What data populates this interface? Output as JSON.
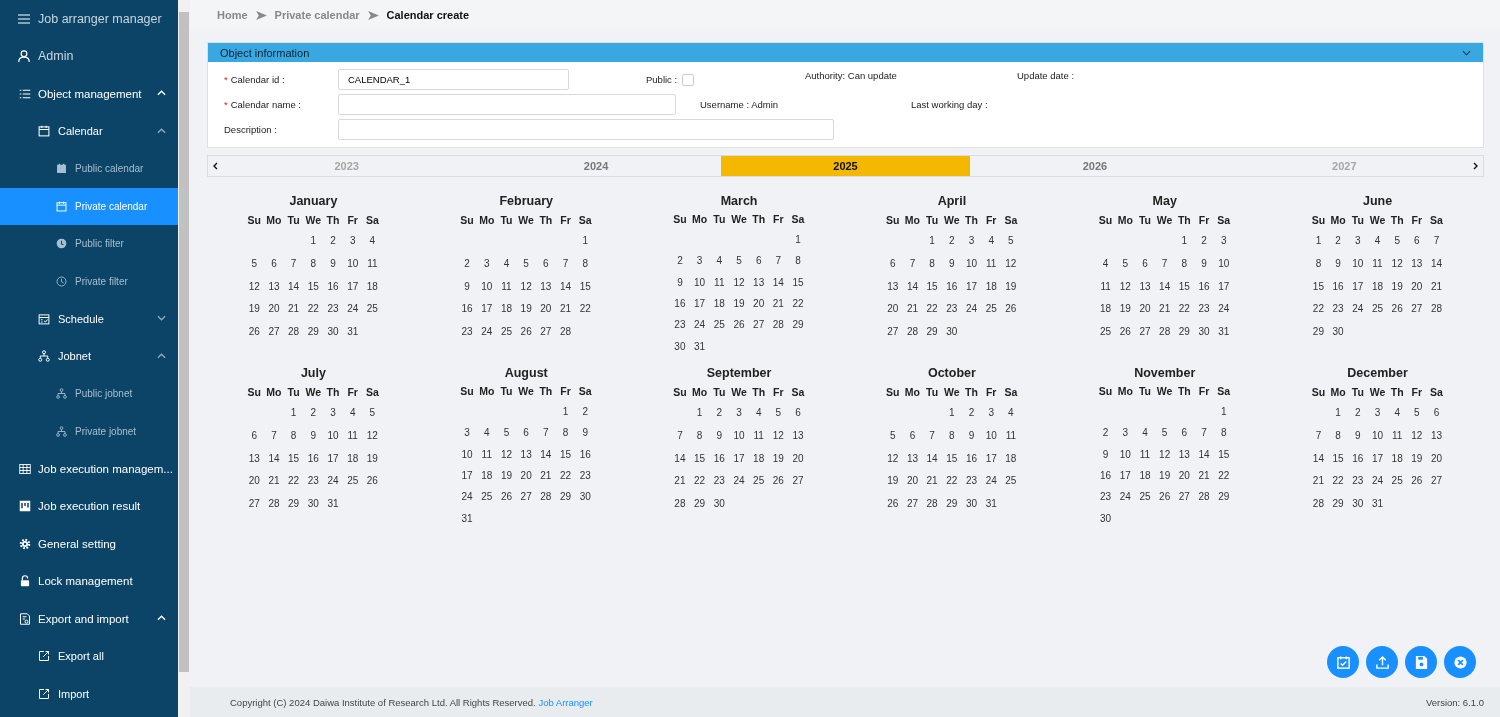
{
  "app": {
    "title": "Job arranger manager"
  },
  "user": {
    "name": "Admin"
  },
  "sidebar": {
    "items": [
      {
        "label": "Object management",
        "selected": false,
        "expanded": true,
        "children": [
          {
            "label": "Calendar",
            "selected": false,
            "expanded": true,
            "children": [
              {
                "label": "Public calendar",
                "selected": false
              },
              {
                "label": "Private calendar",
                "selected": true
              },
              {
                "label": "Public filter",
                "selected": false
              },
              {
                "label": "Private filter",
                "selected": false
              }
            ]
          },
          {
            "label": "Schedule",
            "selected": false,
            "expanded": false
          },
          {
            "label": "Jobnet",
            "selected": false,
            "expanded": true,
            "children": [
              {
                "label": "Public jobnet",
                "selected": false
              },
              {
                "label": "Private jobnet",
                "selected": false
              }
            ]
          }
        ]
      },
      {
        "label": "Job execution managem...",
        "selected": false
      },
      {
        "label": "Job execution result",
        "selected": false
      },
      {
        "label": "General setting",
        "selected": false
      },
      {
        "label": "Lock management",
        "selected": false
      },
      {
        "label": "Export and import",
        "selected": false,
        "expanded": true,
        "children": [
          {
            "label": "Export all",
            "selected": false
          },
          {
            "label": "Import",
            "selected": false
          }
        ]
      }
    ]
  },
  "breadcrumb": [
    {
      "label": "Home",
      "current": false
    },
    {
      "label": "Private calendar",
      "current": false
    },
    {
      "label": "Calendar create",
      "current": true
    }
  ],
  "panel": {
    "title": "Object information",
    "fields": [
      {
        "label": "Calendar id :",
        "mark": "*",
        "value": "CALENDAR_1"
      },
      {
        "label": "Calendar name :",
        "mark": "*"
      },
      {
        "label": "Description :"
      }
    ],
    "public": {
      "label": "Public :",
      "checked": false
    },
    "info": [
      "Authority: Can update",
      "Update date :",
      "Username : Admin",
      "Last working day :"
    ]
  },
  "years": [
    {
      "label": "2023",
      "selected": false,
      "faded": true
    },
    {
      "label": "2024",
      "selected": false,
      "faded": false
    },
    {
      "label": "2025",
      "selected": true,
      "faded": false
    },
    {
      "label": "2026",
      "selected": false,
      "faded": false
    },
    {
      "label": "2027",
      "selected": false,
      "faded": true
    }
  ],
  "months": [
    {
      "name": "January",
      "weekdays": [
        "Su",
        "Mo",
        "Tu",
        "We",
        "Th",
        "Fr",
        "Sa"
      ],
      "weeks": [
        [
          "1",
          "2",
          "3",
          "4"
        ],
        [
          "5",
          "6",
          "7",
          "8",
          "9",
          "10",
          "11"
        ],
        [
          "12",
          "13",
          "14",
          "15",
          "16",
          "17",
          "18"
        ],
        [
          "19",
          "20",
          "21",
          "22",
          "23",
          "24",
          "25"
        ],
        [
          "26",
          "27",
          "28",
          "29",
          "30",
          "31"
        ]
      ]
    },
    {
      "name": "February",
      "weekdays": [
        "Su",
        "Mo",
        "Tu",
        "We",
        "Th",
        "Fr",
        "Sa"
      ],
      "weeks": [
        [
          "1"
        ],
        [
          "2",
          "3",
          "4",
          "5",
          "6",
          "7",
          "8"
        ],
        [
          "9",
          "10",
          "11",
          "12",
          "13",
          "14",
          "15"
        ],
        [
          "16",
          "17",
          "18",
          "19",
          "20",
          "21",
          "22"
        ],
        [
          "23",
          "24",
          "25",
          "26",
          "27",
          "28"
        ]
      ]
    },
    {
      "name": "March",
      "weekdays": [
        "Su",
        "Mo",
        "Tu",
        "We",
        "Th",
        "Fr",
        "Sa"
      ],
      "weeks": [
        [
          "1"
        ],
        [
          "2",
          "3",
          "4",
          "5",
          "6",
          "7",
          "8"
        ],
        [
          "9",
          "10",
          "11",
          "12",
          "13",
          "14",
          "15"
        ],
        [
          "16",
          "17",
          "18",
          "19",
          "20",
          "21",
          "22"
        ],
        [
          "23",
          "24",
          "25",
          "26",
          "27",
          "28",
          "29"
        ],
        [
          "30",
          "31"
        ]
      ]
    },
    {
      "name": "April",
      "weekdays": [
        "Su",
        "Mo",
        "Tu",
        "We",
        "Th",
        "Fr",
        "Sa"
      ],
      "weeks": [
        [
          "1",
          "2",
          "3",
          "4",
          "5"
        ],
        [
          "6",
          "7",
          "8",
          "9",
          "10",
          "11",
          "12"
        ],
        [
          "13",
          "14",
          "15",
          "16",
          "17",
          "18",
          "19"
        ],
        [
          "20",
          "21",
          "22",
          "23",
          "24",
          "25",
          "26"
        ],
        [
          "27",
          "28",
          "29",
          "30"
        ]
      ]
    },
    {
      "name": "May",
      "weekdays": [
        "Su",
        "Mo",
        "Tu",
        "We",
        "Th",
        "Fr",
        "Sa"
      ],
      "weeks": [
        [
          "1",
          "2",
          "3"
        ],
        [
          "4",
          "5",
          "6",
          "7",
          "8",
          "9",
          "10"
        ],
        [
          "11",
          "12",
          "13",
          "14",
          "15",
          "16",
          "17"
        ],
        [
          "18",
          "19",
          "20",
          "21",
          "22",
          "23",
          "24"
        ],
        [
          "25",
          "26",
          "27",
          "28",
          "29",
          "30",
          "31"
        ]
      ]
    },
    {
      "name": "June",
      "weekdays": [
        "Su",
        "Mo",
        "Tu",
        "We",
        "Th",
        "Fr",
        "Sa"
      ],
      "weeks": [
        [
          "1",
          "2",
          "3",
          "4",
          "5",
          "6",
          "7"
        ],
        [
          "8",
          "9",
          "10",
          "11",
          "12",
          "13",
          "14"
        ],
        [
          "15",
          "16",
          "17",
          "18",
          "19",
          "20",
          "21"
        ],
        [
          "22",
          "23",
          "24",
          "25",
          "26",
          "27",
          "28"
        ],
        [
          "29",
          "30"
        ]
      ]
    },
    {
      "name": "July",
      "weekdays": [
        "Su",
        "Mo",
        "Tu",
        "We",
        "Th",
        "Fr",
        "Sa"
      ],
      "weeks": [
        [
          "1",
          "2",
          "3",
          "4",
          "5"
        ],
        [
          "6",
          "7",
          "8",
          "9",
          "10",
          "11",
          "12"
        ],
        [
          "13",
          "14",
          "15",
          "16",
          "17",
          "18",
          "19"
        ],
        [
          "20",
          "21",
          "22",
          "23",
          "24",
          "25",
          "26"
        ],
        [
          "27",
          "28",
          "29",
          "30",
          "31"
        ]
      ]
    },
    {
      "name": "August",
      "weekdays": [
        "Su",
        "Mo",
        "Tu",
        "We",
        "Th",
        "Fr",
        "Sa"
      ],
      "weeks": [
        [
          "1",
          "2"
        ],
        [
          "3",
          "4",
          "5",
          "6",
          "7",
          "8",
          "9"
        ],
        [
          "10",
          "11",
          "12",
          "13",
          "14",
          "15",
          "16"
        ],
        [
          "17",
          "18",
          "19",
          "20",
          "21",
          "22",
          "23"
        ],
        [
          "24",
          "25",
          "26",
          "27",
          "28",
          "29",
          "30"
        ],
        [
          "31"
        ]
      ]
    },
    {
      "name": "September",
      "weekdays": [
        "Su",
        "Mo",
        "Tu",
        "We",
        "Th",
        "Fr",
        "Sa"
      ],
      "weeks": [
        [
          "1",
          "2",
          "3",
          "4",
          "5",
          "6"
        ],
        [
          "7",
          "8",
          "9",
          "10",
          "11",
          "12",
          "13"
        ],
        [
          "14",
          "15",
          "16",
          "17",
          "18",
          "19",
          "20"
        ],
        [
          "21",
          "22",
          "23",
          "24",
          "25",
          "26",
          "27"
        ],
        [
          "28",
          "29",
          "30"
        ]
      ]
    },
    {
      "name": "October",
      "weekdays": [
        "Su",
        "Mo",
        "Tu",
        "We",
        "Th",
        "Fr",
        "Sa"
      ],
      "weeks": [
        [
          "1",
          "2",
          "3",
          "4"
        ],
        [
          "5",
          "6",
          "7",
          "8",
          "9",
          "10",
          "11"
        ],
        [
          "12",
          "13",
          "14",
          "15",
          "16",
          "17",
          "18"
        ],
        [
          "19",
          "20",
          "21",
          "22",
          "23",
          "24",
          "25"
        ],
        [
          "26",
          "27",
          "28",
          "29",
          "30",
          "31"
        ]
      ]
    },
    {
      "name": "November",
      "weekdays": [
        "Su",
        "Mo",
        "Tu",
        "We",
        "Th",
        "Fr",
        "Sa"
      ],
      "weeks": [
        [
          "1"
        ],
        [
          "2",
          "3",
          "4",
          "5",
          "6",
          "7",
          "8"
        ],
        [
          "9",
          "10",
          "11",
          "12",
          "13",
          "14",
          "15"
        ],
        [
          "16",
          "17",
          "18",
          "19",
          "20",
          "21",
          "22"
        ],
        [
          "23",
          "24",
          "25",
          "26",
          "27",
          "28",
          "29"
        ],
        [
          "30"
        ]
      ]
    },
    {
      "name": "December",
      "weekdays": [
        "Su",
        "Mo",
        "Tu",
        "We",
        "Th",
        "Fr",
        "Sa"
      ],
      "weeks": [
        [
          "1",
          "2",
          "3",
          "4",
          "5",
          "6"
        ],
        [
          "7",
          "8",
          "9",
          "10",
          "11",
          "12",
          "13"
        ],
        [
          "14",
          "15",
          "16",
          "17",
          "18",
          "19",
          "20"
        ],
        [
          "21",
          "22",
          "23",
          "24",
          "25",
          "26",
          "27"
        ],
        [
          "28",
          "29",
          "30",
          "31"
        ]
      ]
    }
  ],
  "footer": {
    "copyright": "Copyright (C) 2024 Daiwa Institute of Research Ltd. All Rights Reserved.",
    "link": "Job Arranger",
    "version": "Version: 6.1.0"
  }
}
